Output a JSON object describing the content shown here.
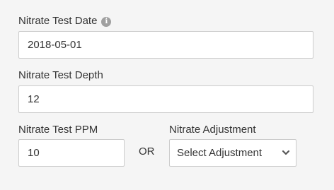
{
  "form": {
    "date": {
      "label": "Nitrate Test Date",
      "value": "2018-05-01"
    },
    "depth": {
      "label": "Nitrate Test Depth",
      "value": "12"
    },
    "ppm": {
      "label": "Nitrate Test PPM",
      "value": "10"
    },
    "or_text": "OR",
    "adjustment": {
      "label": "Nitrate Adjustment",
      "selected": "Select Adjustment"
    }
  },
  "icons": {
    "info": "info-icon",
    "chevron": "chevron-down-icon"
  },
  "colors": {
    "background": "#f5f5f5",
    "border": "#cccccc",
    "text": "#333333",
    "info_icon": "#a0a0a0",
    "chevron": "#555555"
  }
}
